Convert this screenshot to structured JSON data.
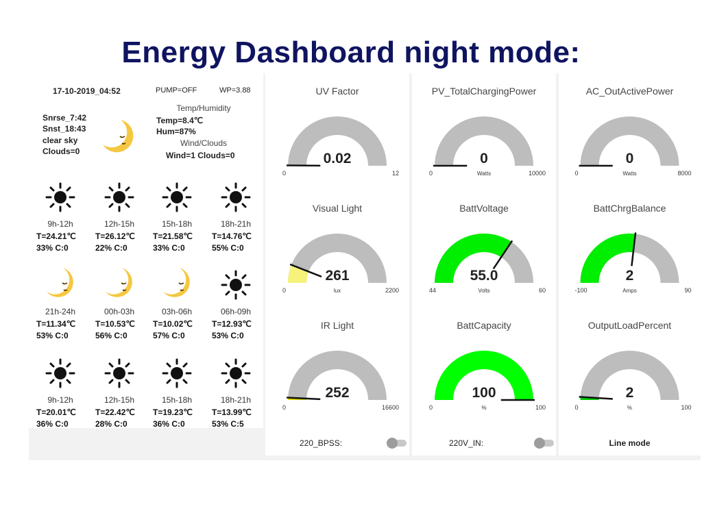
{
  "page": {
    "title": "Energy Dashboard night mode:"
  },
  "weather": {
    "datetime": "17-10-2019_04:52",
    "pump": "PUMP=OFF",
    "wp": "WP=3.88",
    "sunrise": "Snrse_7:42",
    "sunset": "Snst_18:43",
    "condition": "clear sky",
    "clouds": "Clouds=0",
    "temp_hum_label": "Temp/Humidity",
    "temp": "Temp=8.4℃",
    "hum": "Hum=87%",
    "wind_clouds_label": "Wind/Clouds",
    "wind_clouds": "Wind=1 Clouds=0",
    "current_icon": "moon-icon",
    "forecast": [
      {
        "time": "9h-12h",
        "temp": "T=24.21℃",
        "info": "33% C:0",
        "icon": "sun-icon"
      },
      {
        "time": "12h-15h",
        "temp": "T=26.12℃",
        "info": "22% C:0",
        "icon": "sun-icon"
      },
      {
        "time": "15h-18h",
        "temp": "T=21.58℃",
        "info": "33% C:0",
        "icon": "sun-icon"
      },
      {
        "time": "18h-21h",
        "temp": "T=14.76℃",
        "info": "55% C:0",
        "icon": "sun-icon"
      },
      {
        "time": "21h-24h",
        "temp": "T=11.34℃",
        "info": "53% C:0",
        "icon": "moon-icon"
      },
      {
        "time": "00h-03h",
        "temp": "T=10.53℃",
        "info": "56% C:0",
        "icon": "moon-icon"
      },
      {
        "time": "03h-06h",
        "temp": "T=10.02℃",
        "info": "57% C:0",
        "icon": "moon-icon"
      },
      {
        "time": "06h-09h",
        "temp": "T=12.93℃",
        "info": "53% C:0",
        "icon": "sun-icon"
      },
      {
        "time": "9h-12h",
        "temp": "T=20.01℃",
        "info": "36% C:0",
        "icon": "sun-icon"
      },
      {
        "time": "12h-15h",
        "temp": "T=22.42℃",
        "info": "28% C:0",
        "icon": "sun-icon"
      },
      {
        "time": "15h-18h",
        "temp": "T=19.23℃",
        "info": "36% C:0",
        "icon": "sun-icon"
      },
      {
        "time": "18h-21h",
        "temp": "T=13.99℃",
        "info": "53% C:5",
        "icon": "sun-icon"
      }
    ]
  },
  "gauges": [
    {
      "title": "UV Factor",
      "value": "0.02",
      "min": "0",
      "max": "12",
      "unit": "",
      "fraction": 0.002,
      "color": "#4caf50"
    },
    {
      "title": "PV_TotalChargingPower",
      "value": "0",
      "min": "0",
      "max": "10000",
      "unit": "Watts",
      "fraction": 0,
      "color": "#00ff00"
    },
    {
      "title": "AC_OutActivePower",
      "value": "0",
      "min": "0",
      "max": "8000",
      "unit": "Watts",
      "fraction": 0,
      "color": "#00ff00"
    },
    {
      "title": "Visual Light",
      "value": "261",
      "min": "0",
      "max": "2200",
      "unit": "lux",
      "fraction": 0.119,
      "color": "#f7f27a"
    },
    {
      "title": "BattVoltage",
      "value": "55.0",
      "min": "44",
      "max": "60",
      "unit": "Volts",
      "fraction": 0.6875,
      "color": "#00ee00"
    },
    {
      "title": "BattChrgBalance",
      "value": "2",
      "min": "-100",
      "max": "90",
      "unit": "Amps",
      "fraction": 0.537,
      "color": "#00ee00"
    },
    {
      "title": "IR Light",
      "value": "252",
      "min": "0",
      "max": "16600",
      "unit": "",
      "fraction": 0.015,
      "color": "#e0d800"
    },
    {
      "title": "BattCapacity",
      "value": "100",
      "min": "0",
      "max": "100",
      "unit": "%",
      "fraction": 1,
      "color": "#00ff00"
    },
    {
      "title": "OutputLoadPercent",
      "value": "2",
      "min": "0",
      "max": "100",
      "unit": "%",
      "fraction": 0.02,
      "color": "#00cc00"
    }
  ],
  "colors": {
    "title": "#0f1460",
    "gauge_track": "#bdbdbd",
    "needle": "#111111"
  },
  "footer": {
    "bpss_label": "220_BPSS:",
    "vin_label": "220V_IN:",
    "mode": "Line mode"
  }
}
